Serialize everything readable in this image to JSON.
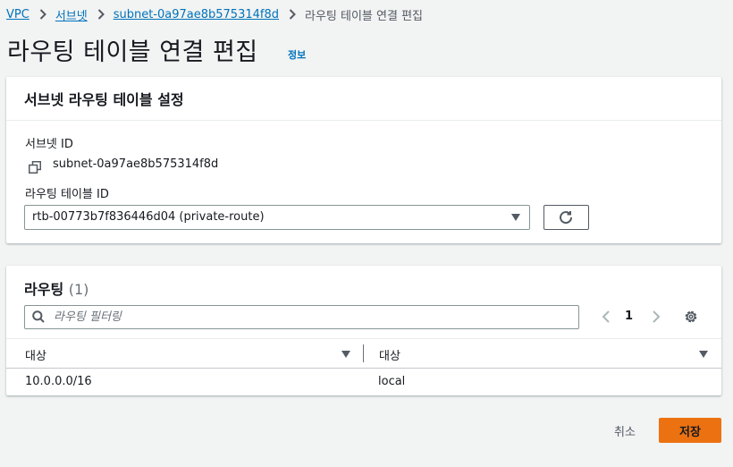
{
  "breadcrumb": {
    "items": [
      "VPC",
      "서브넷",
      "subnet-0a97ae8b575314f8d"
    ],
    "current": "라우팅 테이블 연결 편집"
  },
  "page": {
    "title": "라우팅 테이블 연결 편집",
    "info": "정보"
  },
  "settings_panel": {
    "title": "서브넷 라우팅 테이블 설정",
    "subnet_id_label": "서브넷 ID",
    "subnet_id_value": "subnet-0a97ae8b575314f8d",
    "route_table_label": "라우팅 테이블 ID",
    "route_table_selected": "rtb-00773b7f836446d04 (private-route)"
  },
  "routes_panel": {
    "title": "라우팅",
    "count": "(1)",
    "filter_placeholder": "라우팅 필터링",
    "current_page": "1",
    "columns": [
      "대상",
      "대상"
    ],
    "rows": [
      [
        "10.0.0.0/16",
        "local"
      ]
    ]
  },
  "actions": {
    "cancel": "취소",
    "save": "저장"
  },
  "colors": {
    "primary": "#ec7211",
    "link": "#0073bb",
    "background": "#f2f3f3"
  }
}
